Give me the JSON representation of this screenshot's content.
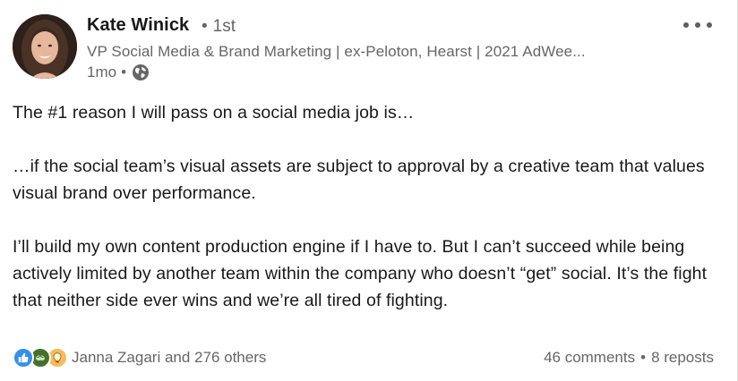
{
  "author": {
    "name": "Kate Winick",
    "connection_degree": "1st",
    "headline": "VP Social Media & Brand Marketing | ex-Peloton, Hearst | 2021 AdWee...",
    "time_ago": "1mo",
    "visibility_icon": "globe-icon"
  },
  "post": {
    "paragraphs": [
      "The #1 reason I will pass on a social media job is…",
      "…if the social team’s visual assets are subject to approval by a creative team that values visual brand over performance.",
      "I’ll build my own content production engine if I have to. But I can’t succeed while being actively limited by another team within the company who doesn’t “get” social. It’s the fight that neither side ever wins and we’re all tired of fighting."
    ]
  },
  "social": {
    "reaction_icons": [
      "like-icon",
      "support-icon",
      "insightful-icon"
    ],
    "reaction_summary": "Janna Zagari and 276 others",
    "comments": "46 comments",
    "reposts": "8 reposts"
  },
  "colors": {
    "like": "#378fe9",
    "support": "#44712e",
    "insightful": "#f5bb5c",
    "muted_text": "#666666",
    "body_text": "#191919"
  }
}
